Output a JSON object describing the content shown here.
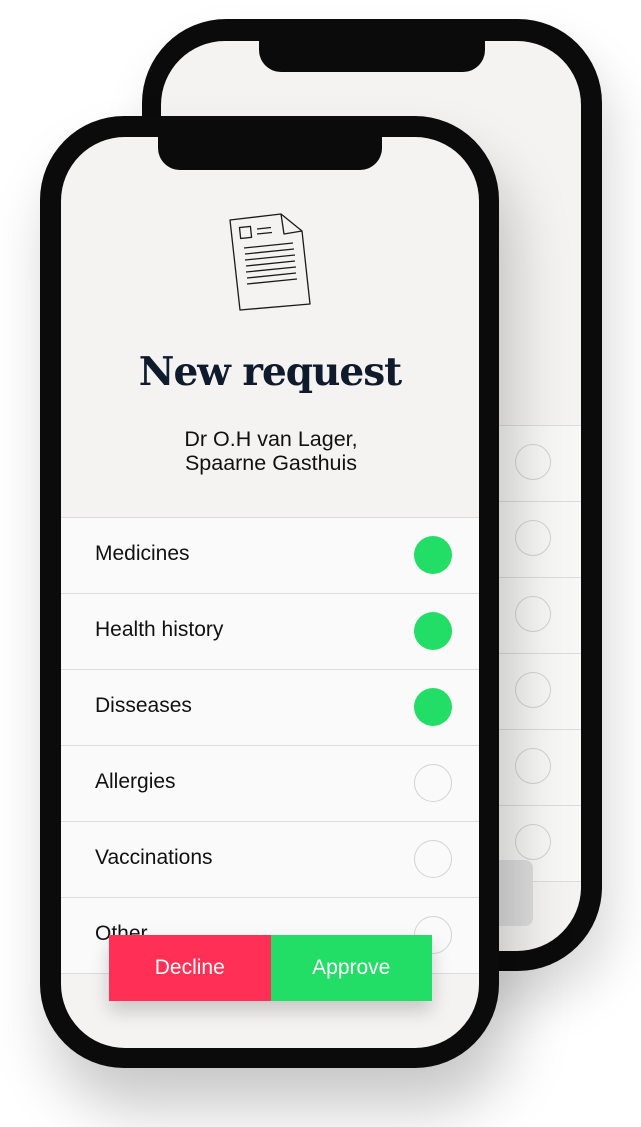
{
  "request": {
    "title": "New request",
    "requester_line1": "Dr O.H van Lager,",
    "requester_line2": "Spaarne Gasthuis"
  },
  "items": [
    {
      "label": "Medicines",
      "selected": true
    },
    {
      "label": "Health history",
      "selected": true
    },
    {
      "label": "Disseases",
      "selected": true
    },
    {
      "label": "Allergies",
      "selected": false
    },
    {
      "label": "Vaccinations",
      "selected": false
    },
    {
      "label": "Other",
      "selected": false
    }
  ],
  "actions": {
    "decline_label": "Decline",
    "approve_label": "Approve"
  },
  "colors": {
    "selected": "#22dd66",
    "decline": "#ff2f55",
    "approve": "#22dd66",
    "title": "#0f1b2d"
  },
  "icons": {
    "header": "document-icon"
  }
}
